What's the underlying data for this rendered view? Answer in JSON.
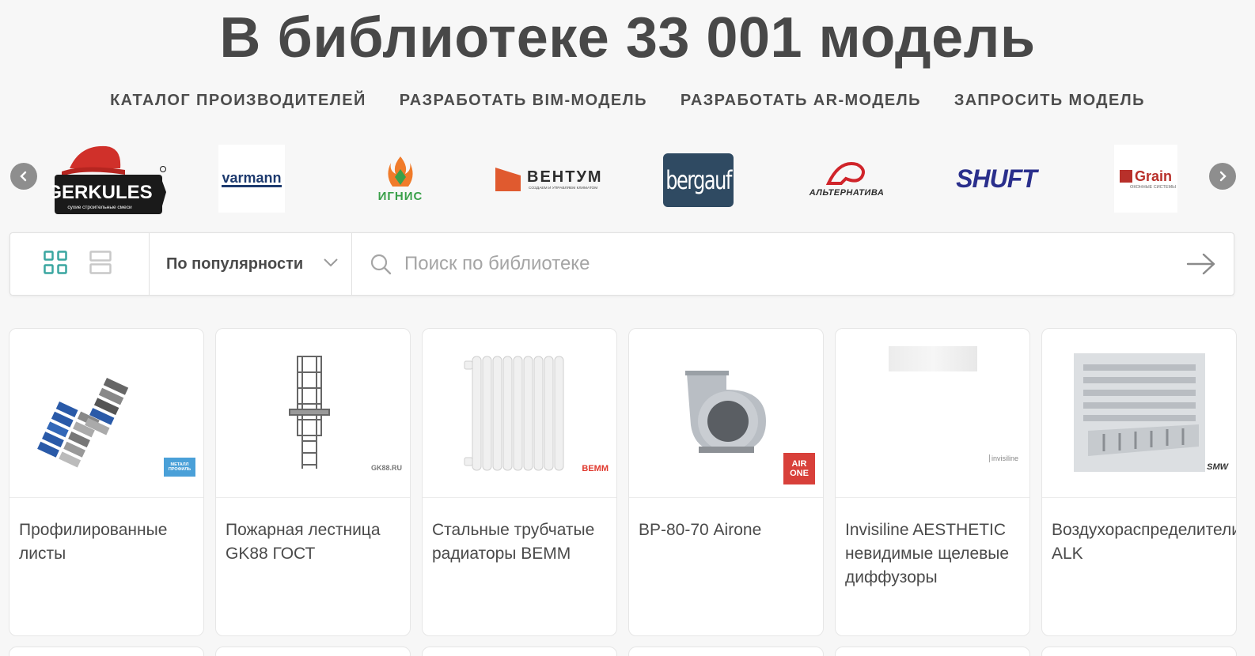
{
  "hero": {
    "title": "В библиотеке 33 001 модель"
  },
  "nav": [
    {
      "label": "КАТАЛОГ ПРОИЗВОДИТЕЛЕЙ"
    },
    {
      "label": "РАЗРАБОТАТЬ BIM-МОДЕЛЬ"
    },
    {
      "label": "РАЗРАБОТАТЬ AR-МОДЕЛЬ"
    },
    {
      "label": "ЗАПРОСИТЬ МОДЕЛЬ"
    }
  ],
  "brands": [
    {
      "name": "GERKULES",
      "sub": "сухие строительные смеси"
    },
    {
      "name": "varmann"
    },
    {
      "name": "ИГНИС"
    },
    {
      "name": "ВЕНТУМ",
      "sub": "СОЗДАЕМ И УПРАВЛЯЕМ КЛИМАТОМ"
    },
    {
      "name": "bergauf"
    },
    {
      "name": "АЛЬТЕРНАТИВА"
    },
    {
      "name": "SHUFT"
    },
    {
      "name": "Grain",
      "sub": "ОКОННЫЕ СИСТЕМЫ"
    }
  ],
  "toolbar": {
    "sort_label": "По популярности",
    "search_placeholder": "Поиск по библиотеке"
  },
  "colors": {
    "accent": "#3aa6a0",
    "brand_red": "#e03a2f",
    "text": "#4a4a4a"
  },
  "cards": [
    {
      "title": "Профилированные листы",
      "badge": "МЕТАЛЛ ПРОФИЛЬ"
    },
    {
      "title": "Пожарная лестница GK88 ГОСТ",
      "badge": "GK88.RU"
    },
    {
      "title": "Стальные трубчатые радиаторы BEMM",
      "badge": "BEMM"
    },
    {
      "title": "ВР-80-70 Airone",
      "badge": "AIR ONE"
    },
    {
      "title": "Invisiline AESTHETIC невидимые щелевые диффузоры",
      "badge": "invisiline"
    },
    {
      "title": "Воздухораспределители ALK",
      "badge": "SMW"
    }
  ]
}
